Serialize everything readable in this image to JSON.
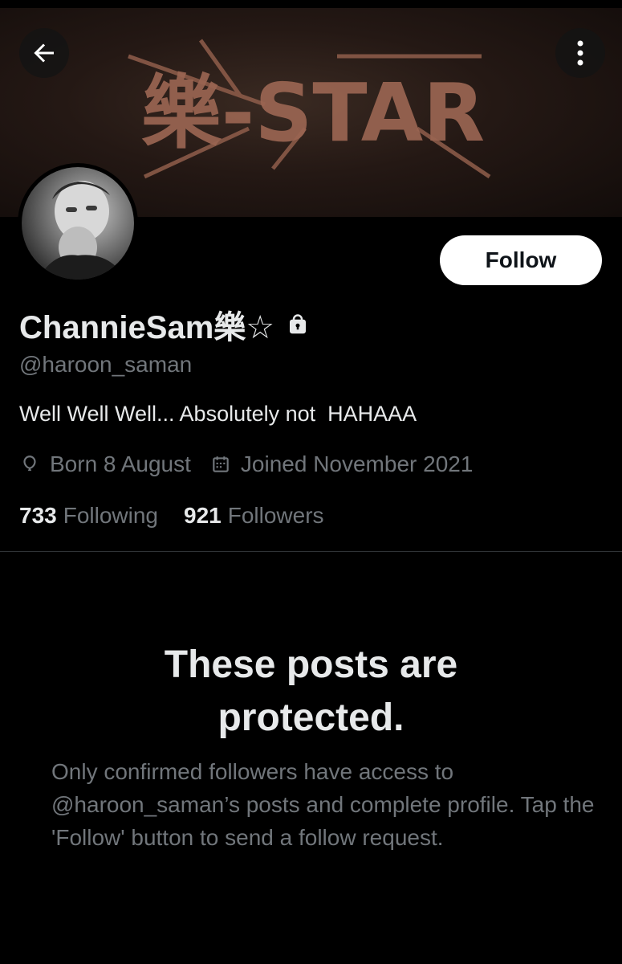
{
  "header": {
    "back_icon": "arrow-left-icon",
    "more_icon": "more-vertical-icon",
    "banner_text": "樂-STAR"
  },
  "profile": {
    "display_name": "ChannieSam樂☆",
    "lock_icon": "lock-icon",
    "handle": "@haroon_saman",
    "bio": "Well Well Well... Absolutely not  HAHAAA",
    "birthday": "Born 8 August",
    "joined": "Joined November 2021",
    "following_count": "733",
    "following_label": "Following",
    "followers_count": "921",
    "followers_label": "Followers",
    "follow_button": "Follow"
  },
  "protected": {
    "title": "These posts are protected.",
    "body": "Only confirmed followers have access to @haroon_saman’s posts and complete profile. Tap the 'Follow' button to send a follow request."
  },
  "colors": {
    "background": "#000000",
    "primary_text": "#e7e9ea",
    "secondary_text": "#71767b",
    "follow_button_bg": "#ffffff"
  }
}
